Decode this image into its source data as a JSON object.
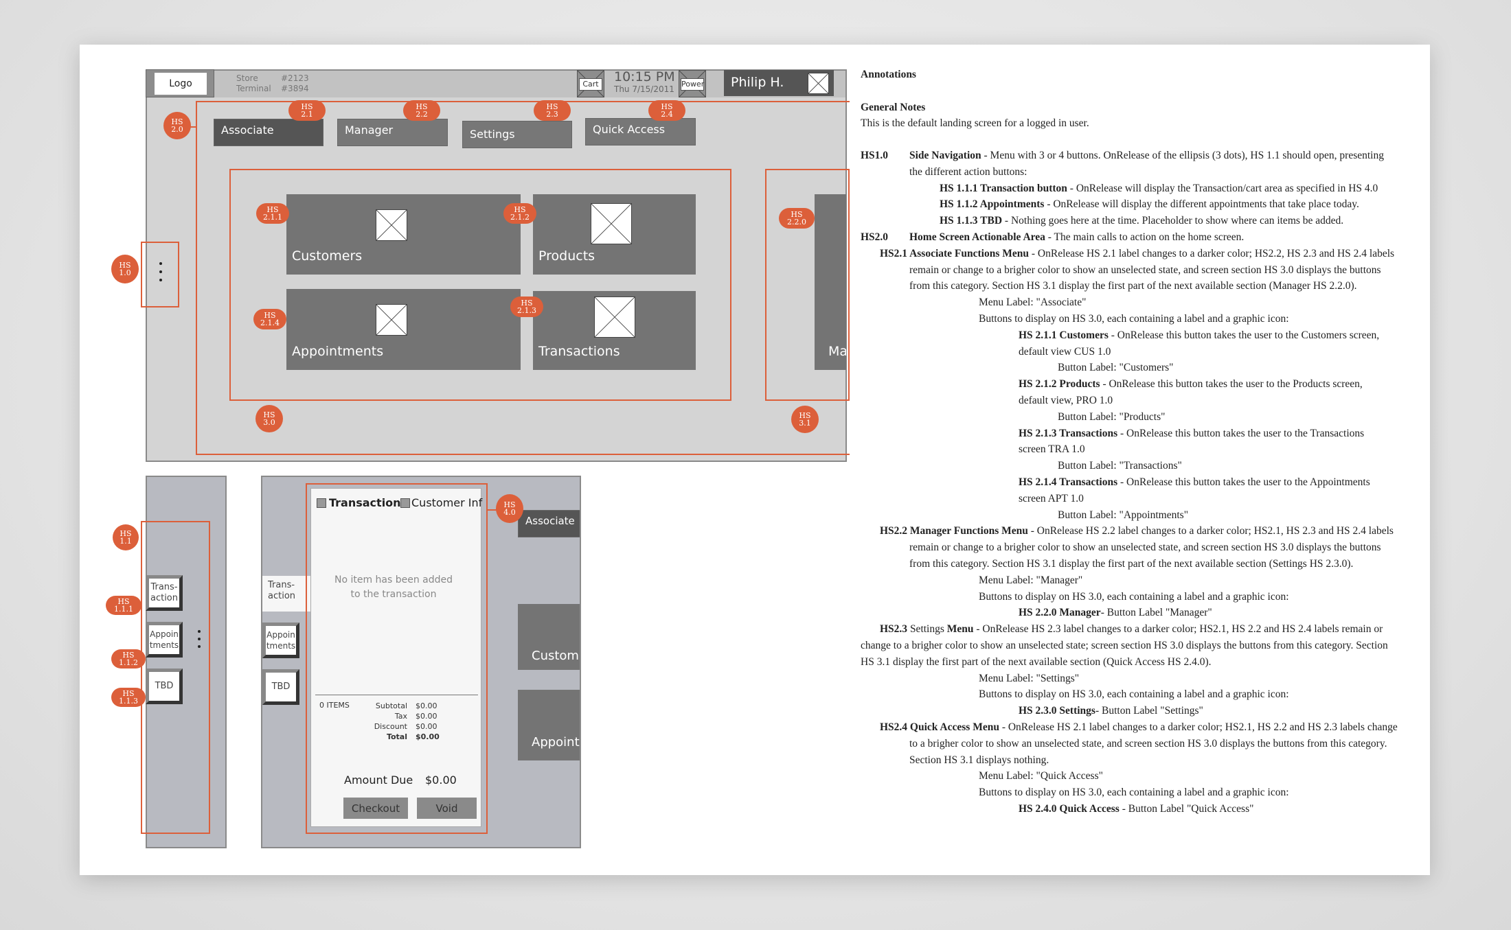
{
  "wireframe": {
    "logo": "Logo",
    "store_label": "Store",
    "store_value": "#2123",
    "terminal_label": "Terminal",
    "terminal_value": "#3894",
    "cart_label": "Cart",
    "time": "10:15 PM",
    "date": "Thu 7/15/2011",
    "power_label": "Power",
    "user_name": "Philip H.",
    "menu": [
      "Associate",
      "Manager",
      "Settings",
      "Quick Access"
    ],
    "tiles": [
      "Customers",
      "Products",
      "Appointments",
      "Transactions"
    ],
    "next_section_tile": "Ma",
    "badges": {
      "hs20": [
        "HS",
        "2.0"
      ],
      "hs21": [
        "HS",
        "2.1"
      ],
      "hs22": [
        "HS",
        "2.2"
      ],
      "hs23": [
        "HS",
        "2.3"
      ],
      "hs24": [
        "HS",
        "2.4"
      ],
      "hs211": [
        "HS",
        "2.1.1"
      ],
      "hs212": [
        "HS",
        "2.1.2"
      ],
      "hs213": [
        "HS",
        "2.1.3"
      ],
      "hs214": [
        "HS",
        "2.1.4"
      ],
      "hs220": [
        "HS",
        "2.2.0"
      ],
      "hs10": [
        "HS",
        "1.0"
      ],
      "hs30": [
        "HS",
        "3.0"
      ],
      "hs31": [
        "HS",
        "3.1"
      ],
      "hs11": [
        "HS",
        "1.1"
      ],
      "hs111": [
        "HS",
        "1.1.1"
      ],
      "hs112": [
        "HS",
        "1.1.2"
      ],
      "hs113": [
        "HS",
        "1.1.3"
      ],
      "hs40": [
        "HS",
        "4.0"
      ]
    }
  },
  "side_nav": {
    "buttons": [
      "Trans-\naction",
      "Appoin\ntments",
      "TBD"
    ]
  },
  "cart_panel": {
    "tab_transaction": "Transaction",
    "tab_customer": "Customer Inf",
    "empty_message": "No item has been added to the transaction",
    "items_count": "0 ITEMS",
    "summary": [
      {
        "label": "Subtotal",
        "value": "$0.00",
        "bold": false
      },
      {
        "label": "Tax",
        "value": "$0.00",
        "bold": false
      },
      {
        "label": "Discount",
        "value": "$0.00",
        "bold": false
      },
      {
        "label": "Total",
        "value": "$0.00",
        "bold": true
      }
    ],
    "amount_due_label": "Amount Due",
    "amount_due_value": "$0.00",
    "checkout": "Checkout",
    "void": "Void",
    "bg_menu_associate": "Associate",
    "bg_tile_customers": "Custome",
    "bg_tile_appointments": "Appointn"
  },
  "annotations": {
    "title": "Annotations",
    "general_heading": "General Notes",
    "general_text": "This is the default landing screen for a logged in user.",
    "lines": [
      {
        "indent": 0,
        "parts": [
          [
            "b",
            "HS1.0"
          ]
        ]
      },
      {
        "indent": 1,
        "parts": [
          [
            "b",
            "Side Navigation"
          ],
          [
            "t",
            " - Menu with 3 or 4 buttons. OnRelease of the ellipsis (3 dots), HS 1.1 should open, presenting"
          ]
        ],
        "same_row_as_prev": true
      },
      {
        "indent": 1,
        "parts": [
          [
            "t",
            "the different action buttons:"
          ]
        ]
      },
      {
        "indent": 2,
        "parts": [
          [
            "b",
            "HS 1.1.1 Transaction button"
          ],
          [
            "t",
            " - OnRelease will display the Transaction/cart area as specified in HS 4.0"
          ]
        ]
      },
      {
        "indent": 2,
        "parts": [
          [
            "b",
            "HS 1.1.2 Appointments"
          ],
          [
            "t",
            " - OnRelease will  display the different appointments that take place today."
          ]
        ]
      },
      {
        "indent": 2,
        "parts": [
          [
            "b",
            "HS 1.1.3 TBD"
          ],
          [
            "t",
            " - Nothing goes here at the time. Placeholder to show where can items be added."
          ]
        ]
      },
      {
        "indent": 0,
        "parts": [
          [
            "b",
            "HS2.0"
          ]
        ]
      },
      {
        "indent": 1,
        "parts": [
          [
            "b",
            "Home Screen Actionable Area"
          ],
          [
            "t",
            " - The main calls to action on the home screen."
          ]
        ],
        "same_row_as_prev": true
      },
      {
        "indent": 5,
        "parts": [
          [
            "b",
            "HS2.1 Associate Functions Menu"
          ],
          [
            "t",
            " - OnRelease HS 2.1 label changes to a darker color; HS2.2, HS 2.3 and HS 2.4 labels"
          ]
        ]
      },
      {
        "indent": 1,
        "parts": [
          [
            "t",
            "remain or change to a brigher color to show an unselected state, and screen section HS 3.0 displays the buttons"
          ]
        ]
      },
      {
        "indent": 1,
        "parts": [
          [
            "t",
            "from this category. Section HS 3.1 display the first part of the next available section (Manager HS 2.2.0)."
          ]
        ]
      },
      {
        "indent": 3,
        "parts": [
          [
            "t",
            "Menu Label: \"Associate\""
          ]
        ]
      },
      {
        "indent": 3,
        "parts": [
          [
            "t",
            "Buttons to display on HS 3.0, each containing a label and a graphic icon:"
          ]
        ]
      },
      {
        "indent": 4,
        "parts": [
          [
            "b",
            "HS 2.1.1 Customers"
          ],
          [
            "t",
            " - OnRelease this button takes the user to the Customers screen,"
          ]
        ]
      },
      {
        "indent": 4,
        "parts": [
          [
            "t",
            "default view CUS 1.0"
          ]
        ]
      },
      {
        "indent": 6,
        "parts": [
          [
            "t",
            "Button Label: \"Customers\""
          ]
        ]
      },
      {
        "indent": 4,
        "parts": [
          [
            "b",
            "HS 2.1.2 Products"
          ],
          [
            "t",
            " - OnRelease this button takes the user to the Products screen,"
          ]
        ]
      },
      {
        "indent": 4,
        "parts": [
          [
            "t",
            "default view, PRO 1.0"
          ]
        ]
      },
      {
        "indent": 6,
        "parts": [
          [
            "t",
            "Button Label: \"Products\""
          ]
        ]
      },
      {
        "indent": 4,
        "parts": [
          [
            "b",
            "HS 2.1.3 Transactions"
          ],
          [
            "t",
            " - OnRelease this button takes the user to the Transactions"
          ]
        ]
      },
      {
        "indent": 4,
        "parts": [
          [
            "t",
            "screen TRA 1.0"
          ]
        ]
      },
      {
        "indent": 6,
        "parts": [
          [
            "t",
            "Button Label: \"Transactions\""
          ]
        ]
      },
      {
        "indent": 4,
        "parts": [
          [
            "b",
            "HS 2.1.4 Transactions"
          ],
          [
            "t",
            " - OnRelease this button takes the user to the Appointments"
          ]
        ]
      },
      {
        "indent": 4,
        "parts": [
          [
            "t",
            "screen APT 1.0"
          ]
        ]
      },
      {
        "indent": 6,
        "parts": [
          [
            "t",
            "Button Label: \"Appointments\""
          ]
        ]
      },
      {
        "indent": 5,
        "parts": [
          [
            "b",
            "HS2.2 Manager Functions Menu"
          ],
          [
            "t",
            " - OnRelease HS 2.2 label changes to a darker color; HS2.1, HS 2.3 and HS 2.4 labels"
          ]
        ]
      },
      {
        "indent": 1,
        "parts": [
          [
            "t",
            "remain or change to a brigher color to show an unselected state, and screen section HS 3.0 displays the buttons"
          ]
        ]
      },
      {
        "indent": 1,
        "parts": [
          [
            "t",
            "from this category. Section HS 3.1 display the first part of the next available section (Settings HS 2.3.0)."
          ]
        ]
      },
      {
        "indent": 3,
        "parts": [
          [
            "t",
            "Menu Label: \"Manager\""
          ]
        ]
      },
      {
        "indent": 3,
        "parts": [
          [
            "t",
            "Buttons to display on HS 3.0, each containing a label and a graphic icon:"
          ]
        ]
      },
      {
        "indent": 4,
        "parts": [
          [
            "b",
            "HS 2.2.0 Manager"
          ],
          [
            "t",
            "- Button Label \"Manager\""
          ]
        ]
      },
      {
        "indent": 5,
        "parts": [
          [
            "b",
            "HS2.3"
          ],
          [
            "t",
            " Settings "
          ],
          [
            "b",
            "Menu"
          ],
          [
            "t",
            " -  OnRelease HS 2.3 label changes to a darker color; HS2.1, HS 2.2 and HS 2.4 labels remain or"
          ]
        ]
      },
      {
        "indent": 0,
        "parts": [
          [
            "t",
            "change to a brigher color to show an unselected state; screen section HS 3.0 displays the buttons from this category. Section"
          ]
        ]
      },
      {
        "indent": 0,
        "parts": [
          [
            "t",
            "HS 3.1 display the first part of the next available section (Quick Access HS 2.4.0)."
          ]
        ]
      },
      {
        "indent": 3,
        "parts": [
          [
            "t",
            "Menu Label: \"Settings\""
          ]
        ]
      },
      {
        "indent": 3,
        "parts": [
          [
            "t",
            "Buttons to display on HS 3.0, each containing a label and a graphic icon:"
          ]
        ]
      },
      {
        "indent": 4,
        "parts": [
          [
            "b",
            "HS 2.3.0 Settings"
          ],
          [
            "t",
            "- Button Label \"Settings\""
          ]
        ]
      },
      {
        "indent": 5,
        "parts": [
          [
            "b",
            "HS2.4 Quick Access Menu"
          ],
          [
            "t",
            " -  OnRelease HS 2.1 label changes to a darker color; HS2.1, HS 2.2 and HS 2.3 labels change"
          ]
        ]
      },
      {
        "indent": 1,
        "parts": [
          [
            "t",
            "to a brigher color to show an unselected state, and screen section HS 3.0 displays the buttons from this category."
          ]
        ]
      },
      {
        "indent": 1,
        "parts": [
          [
            "t",
            "Section HS 3.1 displays nothing."
          ]
        ]
      },
      {
        "indent": 3,
        "parts": [
          [
            "t",
            "Menu Label: \"Quick Access\""
          ]
        ]
      },
      {
        "indent": 3,
        "parts": [
          [
            "t",
            "Buttons to display on HS 3.0, each containing a label and a graphic icon:"
          ]
        ]
      },
      {
        "indent": 4,
        "parts": [
          [
            "b",
            "HS 2.4.0 Quick Access"
          ],
          [
            "t",
            " - Button Label \"Quick Access\""
          ]
        ]
      }
    ]
  },
  "colors": {
    "accent": "#dc5f3a",
    "wire_bg": "#d4d4d4",
    "tile": "#747474",
    "panel": "#b8bac1"
  }
}
